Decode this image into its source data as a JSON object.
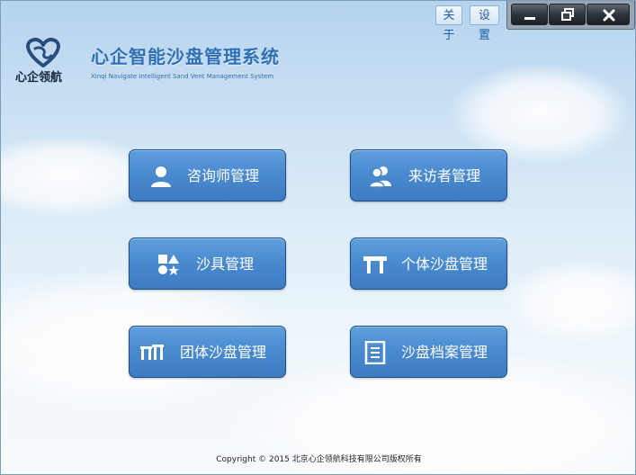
{
  "header": {
    "logo_text": "心企领航",
    "title": "心企智能沙盘管理系统",
    "subtitle": "Xinqi Navigate Intelligent Sand Vent Management System"
  },
  "top_buttons": {
    "about": "关于",
    "settings": "设置"
  },
  "menu": [
    {
      "label": "咨询师管理",
      "icon": "user-icon"
    },
    {
      "label": "来访者管理",
      "icon": "users-icon"
    },
    {
      "label": "沙具管理",
      "icon": "shapes-icon"
    },
    {
      "label": "个体沙盘管理",
      "icon": "table-icon"
    },
    {
      "label": "团体沙盘管理",
      "icon": "group-tables-icon"
    },
    {
      "label": "沙盘档案管理",
      "icon": "document-icon"
    }
  ],
  "footer": {
    "copyright": "Copyright © 2015 北京心企领航科技有限公司版权所有"
  },
  "colors": {
    "button": "#4a8bd0",
    "button_border": "#1e4f86",
    "title": "#2f6fb3",
    "logo": "#2a4d7f"
  }
}
